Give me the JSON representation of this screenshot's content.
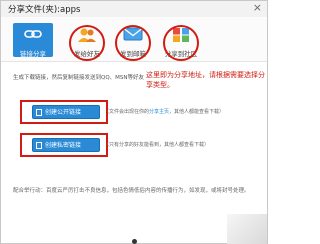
{
  "window": {
    "title": "分享文件(夹):apps",
    "close": "×"
  },
  "tabs": [
    {
      "label": "链接分享",
      "icon": "link-icon"
    },
    {
      "label": "发给好友",
      "icon": "friends-icon"
    },
    {
      "label": "发到邮箱",
      "icon": "mail-icon"
    },
    {
      "label": "分享到社区",
      "icon": "community-icon"
    }
  ],
  "description": "生成下载链接，然后复制链接发送到QQ、MSN等好友",
  "annotation": "这里即为分享地址，请根据需要选择分享类型。",
  "public_link": {
    "button": "创建公开链接",
    "note_prefix": "（文件会出现在你的",
    "note_highlight": "分享主页",
    "note_suffix": "，其他人都能查看下载）"
  },
  "private_link": {
    "button": "创建私密链接",
    "note": "（只有分享的好友能看到，其他人都查看下载）"
  },
  "footer": "配合举行动：百度云严厉打击不良信息，包括色情低俗内容的传播行为，如发现，或将封号处理。",
  "colors": {
    "accent": "#2a8ad6",
    "annotation_red": "#d01c12"
  }
}
